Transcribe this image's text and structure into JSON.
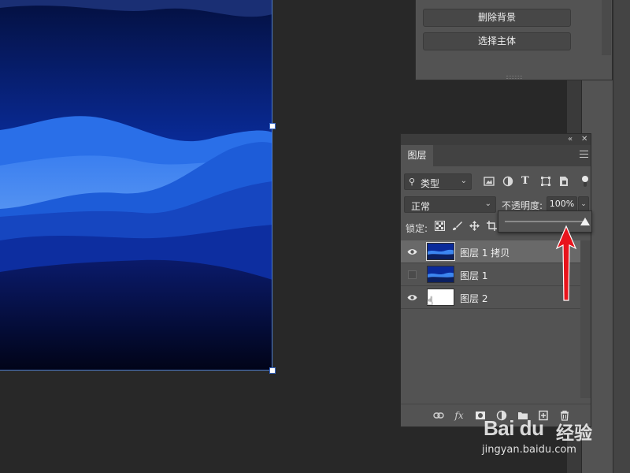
{
  "properties_panel": {
    "remove_background_label": "删除背景",
    "select_subject_label": "选择主体"
  },
  "layers_panel": {
    "tab_label": "图层",
    "filter": {
      "selected": "类型"
    },
    "blend_mode": "正常",
    "opacity_label": "不透明度:",
    "opacity_value": "100%",
    "opacity_slider_value": 1.0,
    "lock_label": "锁定:",
    "layers": [
      {
        "name": "图层 1 拷贝",
        "visible": true,
        "selected": true,
        "thumbnail": "blue-landscape"
      },
      {
        "name": "图层 1",
        "visible": false,
        "selected": false,
        "thumbnail": "blue-landscape"
      },
      {
        "name": "图层 2",
        "visible": true,
        "selected": false,
        "thumbnail": "white"
      }
    ]
  },
  "icons": {
    "filter": [
      "image-icon",
      "adjustment-icon",
      "type-icon",
      "shape-icon",
      "smart-object-icon"
    ],
    "lock": [
      "lock-pixels-icon",
      "lock-paint-icon",
      "lock-move-icon",
      "lock-artboard-icon"
    ],
    "bottom": [
      "link-icon",
      "fx-icon",
      "mask-icon",
      "adjustment-layer-icon",
      "group-icon",
      "new-layer-icon",
      "trash-icon"
    ]
  },
  "colors": {
    "panel_bg": "#535353",
    "workspace_bg": "#282828",
    "selected_row": "#696969",
    "annotation_arrow": "#e8141c"
  },
  "watermark": {
    "logo": "Bai du",
    "cn": "经验",
    "url": "jingyan.baidu.com"
  }
}
